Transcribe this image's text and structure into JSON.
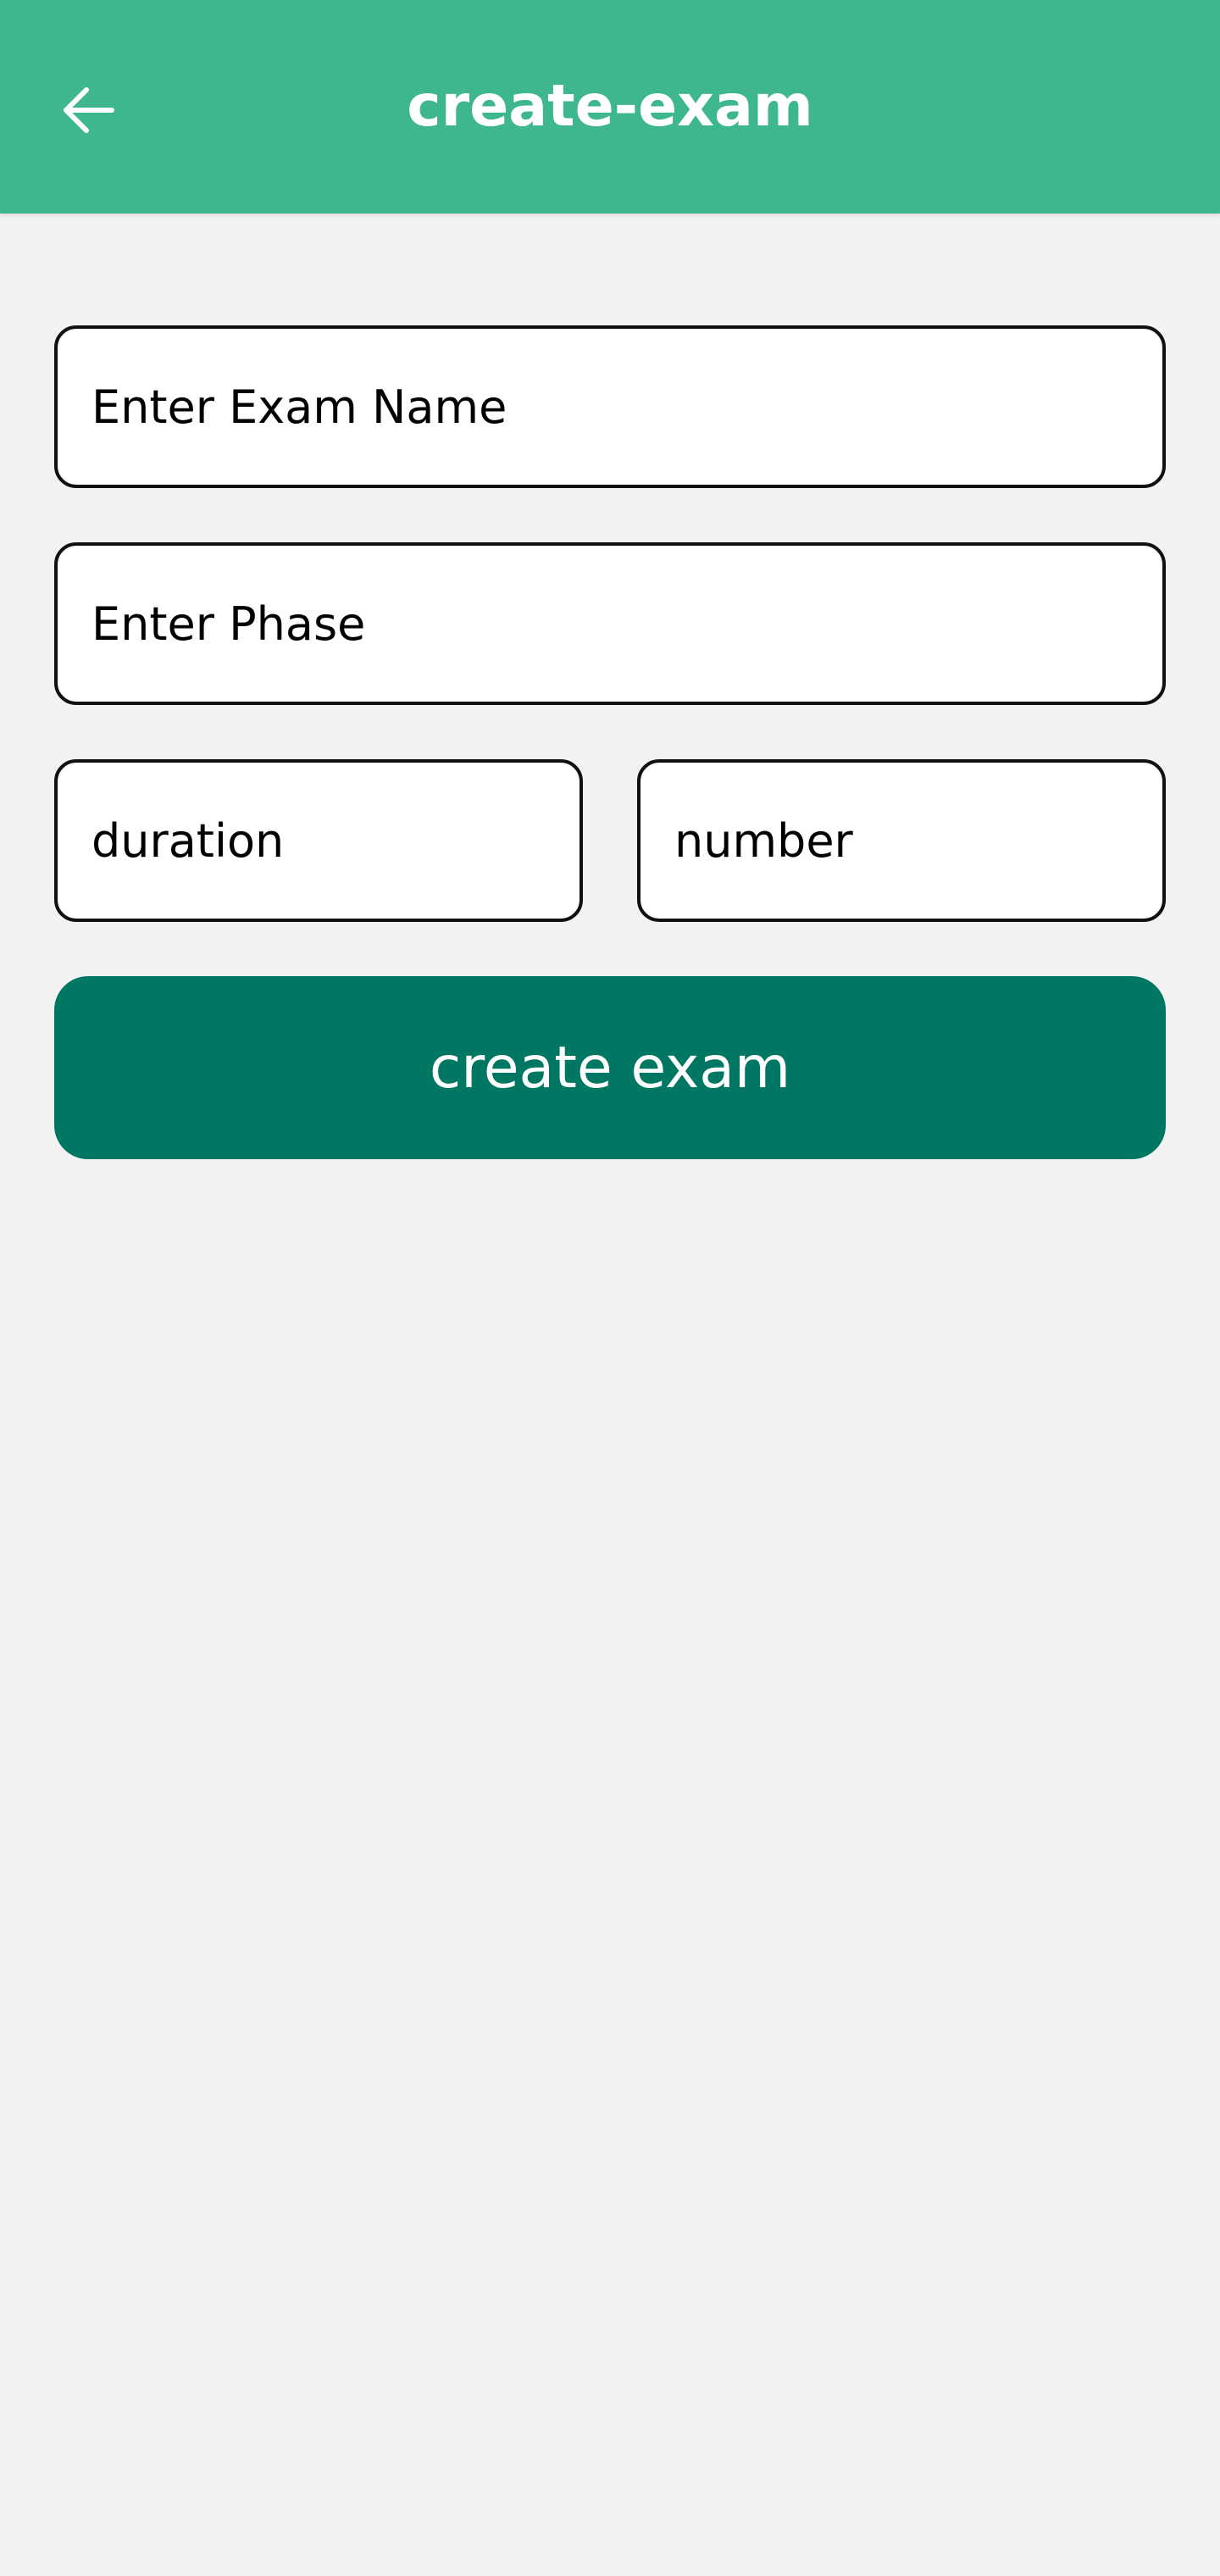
{
  "app_bar": {
    "title": "create-exam",
    "back_icon": "arrow-left-icon",
    "background": "#3db78b"
  },
  "form": {
    "exam_name": {
      "value": "",
      "placeholder": "Enter Exam Name"
    },
    "phase": {
      "value": "",
      "placeholder": "Enter Phase"
    },
    "duration": {
      "value": "",
      "placeholder": "duration"
    },
    "number": {
      "value": "",
      "placeholder": "number"
    },
    "submit_label": "create exam",
    "submit_color": "#007763"
  }
}
